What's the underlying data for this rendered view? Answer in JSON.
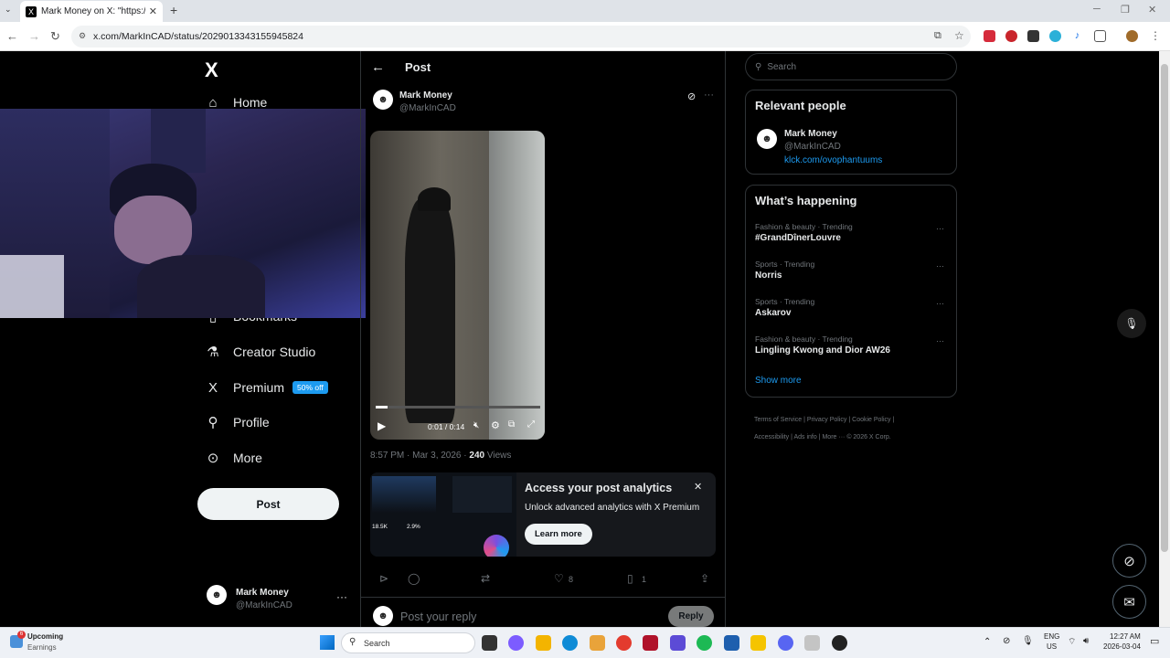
{
  "browser": {
    "tab_title": "Mark Money on X: \"https://t.co",
    "tab_favicon": "X",
    "url": "x.com/MarkInCAD/status/2029013343155945824"
  },
  "sidebar": {
    "logo": "X",
    "items": [
      {
        "label": "Home",
        "icon": "home-icon"
      },
      {
        "label": "Bookmarks",
        "icon": "bookmark-icon"
      },
      {
        "label": "Creator Studio",
        "icon": "flask-icon"
      },
      {
        "label": "Premium",
        "icon": "x-icon",
        "badge": "50% off"
      },
      {
        "label": "Profile",
        "icon": "person-icon"
      },
      {
        "label": "More",
        "icon": "more-circle-icon"
      }
    ],
    "post_button": "Post",
    "account": {
      "name": "Mark Money",
      "handle": "@MarkInCAD"
    }
  },
  "post": {
    "header_title": "Post",
    "author_name": "Mark Money",
    "author_handle": "@MarkInCAD",
    "video_time": "0:01 / 0:14",
    "video_progress": 0.07,
    "timestamp": "8:57 PM · Mar 3, 2026 · ",
    "views_count": "240",
    "views_label": " Views",
    "analytics": {
      "title": "Access your post analytics",
      "subtitle": "Unlock advanced analytics with X Premium",
      "button": "Learn more",
      "stat1": "18.5K",
      "stat2": "2.9%"
    },
    "actions": {
      "likes": "8",
      "bookmarks": "1"
    },
    "reply_placeholder": "Post your reply",
    "reply_button": "Reply"
  },
  "right": {
    "search_placeholder": "Search",
    "relevant_title": "Relevant people",
    "relevant": {
      "name": "Mark Money",
      "handle": "@MarkInCAD",
      "link": "klck.com/ovophantuums"
    },
    "happening_title": "What’s happening",
    "trends": [
      {
        "meta": "Fashion & beauty · Trending",
        "name": "#GrandDînerLouvre"
      },
      {
        "meta": "Sports · Trending",
        "name": "Norris"
      },
      {
        "meta": "Sports · Trending",
        "name": "Askarov"
      },
      {
        "meta": "Fashion & beauty · Trending",
        "name": "Lingling Kwong and Dior AW26"
      }
    ],
    "show_more": "Show more",
    "footer": [
      "Terms of Service",
      "Privacy Policy",
      "Cookie Policy",
      "Accessibility",
      "Ads info",
      "More ···",
      "© 2026 X Corp."
    ]
  },
  "taskbar": {
    "widget_badge": "6",
    "widget_title": "Upcoming",
    "widget_sub": "Earnings",
    "search": "Search",
    "lang1": "ENG",
    "lang2": "US",
    "time": "12:27 AM",
    "date": "2026-03-04"
  },
  "colors": {
    "accent": "#1d9bf0",
    "background": "#000000",
    "text": "#e7e9ea",
    "muted": "#71767b"
  }
}
